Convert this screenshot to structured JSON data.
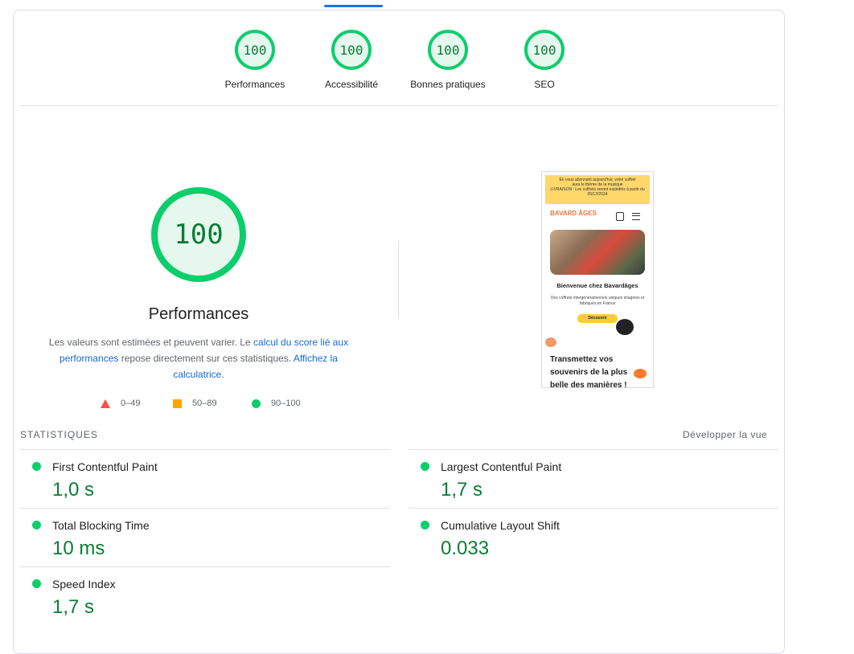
{
  "categories": [
    {
      "score": "100",
      "label": "Performances"
    },
    {
      "score": "100",
      "label": "Accessibilité"
    },
    {
      "score": "100",
      "label": "Bonnes pratiques"
    },
    {
      "score": "100",
      "label": "SEO"
    }
  ],
  "main": {
    "score": "100",
    "title": "Performances",
    "desc_1": "Les valeurs sont estimées et peuvent varier. Le ",
    "desc_link_1": "calcul du score lié aux performances",
    "desc_2": " repose directement sur ces statistiques. ",
    "desc_link_2": "Affichez la calculatrice",
    "desc_3": "."
  },
  "legend": {
    "fail": "0–49",
    "average": "50–89",
    "pass": "90–100"
  },
  "screenshot": {
    "banner_line_1": "En vous abonnant aujourd'hui, votre coffret",
    "banner_line_2": "aura le thème de la musique",
    "banner_line_3": "LIVRAISON : Les coffrets seront expédiés à partir du 05/12/2024",
    "logo": "BAVARD ÂGES",
    "welcome": "Bienvenue chez Bavardâges",
    "subtitle": "Des coffrets intergénérationnels uniques imaginés et fabriqués en France",
    "cta": "Découvrir",
    "transmit": "Transmettez vos souvenirs de la plus belle des manières !"
  },
  "stats": {
    "header": "STATISTIQUES",
    "toggle": "Développer la vue",
    "metrics": [
      {
        "title": "First Contentful Paint",
        "value": "1,0 s"
      },
      {
        "title": "Largest Contentful Paint",
        "value": "1,7 s"
      },
      {
        "title": "Total Blocking Time",
        "value": "10 ms"
      },
      {
        "title": "Cumulative Layout Shift",
        "value": "0.033"
      },
      {
        "title": "Speed Index",
        "value": "1,7 s"
      }
    ]
  },
  "colors": {
    "pass": "#0cce6b",
    "pass_text": "#0a7d34",
    "average": "#ffa400",
    "fail": "#ff4e42",
    "link": "#1967d2"
  }
}
